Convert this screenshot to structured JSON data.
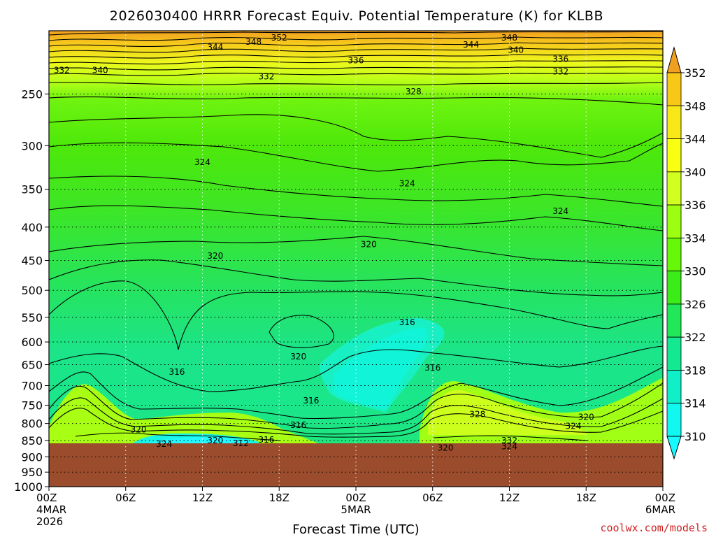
{
  "title": "2026030400 HRRR Forecast Equiv. Potential Temperature (K) for KLBB",
  "xlabel": "Forecast Time (UTC)",
  "credit": "coolwx.com/models",
  "colors": {
    "terrain": "#9b4c2c",
    "contour": "#000000",
    "credit": "#cc2222"
  },
  "colorbar": {
    "labels": [
      "352",
      "348",
      "344",
      "340",
      "336",
      "334",
      "330",
      "326",
      "322",
      "318",
      "314",
      "310"
    ],
    "colors": [
      "#f0a020",
      "#f8c818",
      "#f8e818",
      "#f8ff10",
      "#d0ff20",
      "#9cff10",
      "#66f808",
      "#3cec18",
      "#20e858",
      "#14e890",
      "#10f0c8",
      "#10f8f0",
      "#18f8ff"
    ]
  },
  "chart_data": {
    "type": "heatmap",
    "title": "2026030400 HRRR Forecast Equiv. Potential Temperature (K) for KLBB",
    "xlabel": "Forecast Time (UTC)",
    "ylabel": "",
    "x_ticks": [
      {
        "label": "00Z",
        "sub": [
          "4MAR",
          "2026"
        ],
        "hour": 0
      },
      {
        "label": "06Z",
        "sub": [],
        "hour": 6
      },
      {
        "label": "12Z",
        "sub": [],
        "hour": 12
      },
      {
        "label": "18Z",
        "sub": [],
        "hour": 18
      },
      {
        "label": "00Z",
        "sub": [
          "5MAR"
        ],
        "hour": 24
      },
      {
        "label": "06Z",
        "sub": [],
        "hour": 30
      },
      {
        "label": "12Z",
        "sub": [],
        "hour": 36
      },
      {
        "label": "18Z",
        "sub": [],
        "hour": 42
      },
      {
        "label": "00Z",
        "sub": [
          "6MAR"
        ],
        "hour": 48
      }
    ],
    "x_range": [
      0,
      48
    ],
    "y_ticks": [
      250,
      300,
      350,
      400,
      450,
      500,
      550,
      600,
      650,
      700,
      750,
      800,
      850,
      900,
      950,
      1000
    ],
    "y_range": [
      200,
      1000
    ],
    "y_scale": "log",
    "y_reversed": true,
    "grid": true,
    "surface_pressure": 897,
    "levels": [
      310,
      312,
      314,
      316,
      318,
      320,
      322,
      324,
      326,
      328,
      330,
      332,
      334,
      336,
      338,
      340,
      342,
      344,
      346,
      348,
      350,
      352
    ],
    "contour_labels": [
      {
        "text": "352",
        "hour": 18.0,
        "p": 205
      },
      {
        "text": "348",
        "hour": 16.0,
        "p": 208
      },
      {
        "text": "344",
        "hour": 13.0,
        "p": 212
      },
      {
        "text": "332",
        "hour": 1.0,
        "p": 230
      },
      {
        "text": "340",
        "hour": 4.0,
        "p": 230
      },
      {
        "text": "332",
        "hour": 17.0,
        "p": 235
      },
      {
        "text": "336",
        "hour": 24.0,
        "p": 222
      },
      {
        "text": "328",
        "hour": 28.5,
        "p": 248
      },
      {
        "text": "344",
        "hour": 33.0,
        "p": 210
      },
      {
        "text": "348",
        "hour": 36.0,
        "p": 205
      },
      {
        "text": "340",
        "hour": 36.5,
        "p": 214
      },
      {
        "text": "336",
        "hour": 40.0,
        "p": 221
      },
      {
        "text": "332",
        "hour": 40.0,
        "p": 231
      },
      {
        "text": "324",
        "hour": 12.0,
        "p": 318
      },
      {
        "text": "324",
        "hour": 28.0,
        "p": 343
      },
      {
        "text": "324",
        "hour": 40.0,
        "p": 378
      },
      {
        "text": "320",
        "hour": 13.0,
        "p": 443
      },
      {
        "text": "320",
        "hour": 25.0,
        "p": 425
      },
      {
        "text": "316",
        "hour": 28.0,
        "p": 560
      },
      {
        "text": "316",
        "hour": 10.0,
        "p": 667
      },
      {
        "text": "320",
        "hour": 19.5,
        "p": 632
      },
      {
        "text": "316",
        "hour": 30.0,
        "p": 657
      },
      {
        "text": "316",
        "hour": 20.5,
        "p": 738
      },
      {
        "text": "328",
        "hour": 33.5,
        "p": 775
      },
      {
        "text": "320",
        "hour": 42.0,
        "p": 782
      },
      {
        "text": "324",
        "hour": 41.0,
        "p": 808
      },
      {
        "text": "316",
        "hour": 19.5,
        "p": 805
      },
      {
        "text": "320",
        "hour": 7.0,
        "p": 818
      },
      {
        "text": "320",
        "hour": 13.0,
        "p": 850
      },
      {
        "text": "324",
        "hour": 9.0,
        "p": 860
      },
      {
        "text": "316",
        "hour": 17.0,
        "p": 848
      },
      {
        "text": "312",
        "hour": 15.0,
        "p": 858
      },
      {
        "text": "332",
        "hour": 36.0,
        "p": 850
      },
      {
        "text": "324",
        "hour": 36.0,
        "p": 868
      },
      {
        "text": "320",
        "hour": 31.0,
        "p": 872
      }
    ]
  }
}
